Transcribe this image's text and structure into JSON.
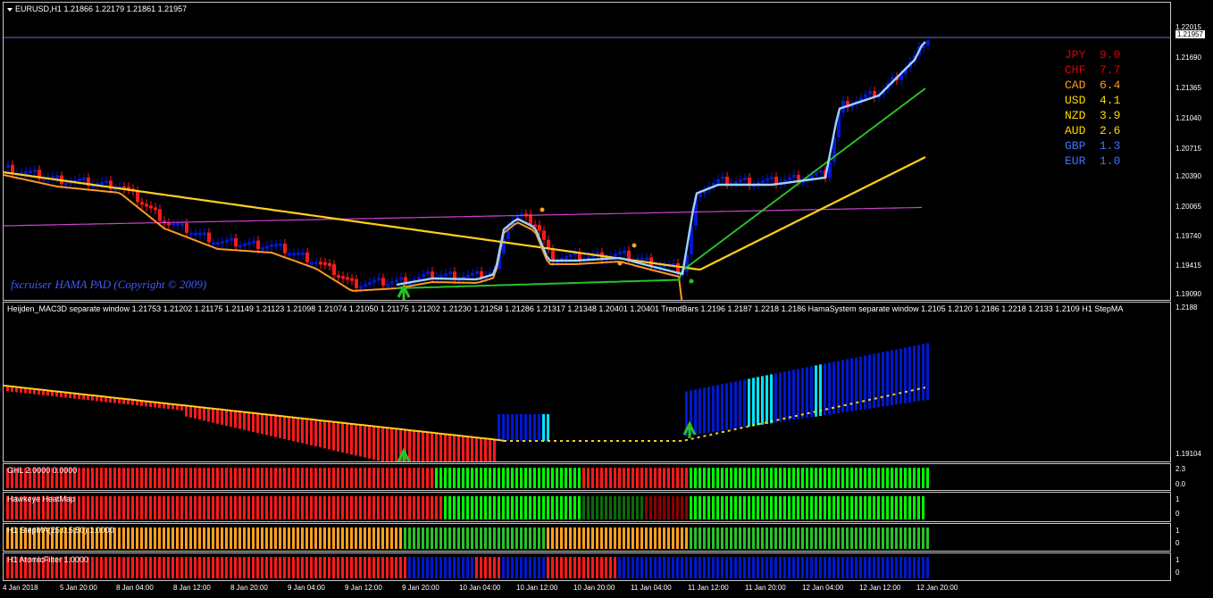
{
  "main_label": "EURUSD,H1  1.21866 1.22179 1.21861 1.21957",
  "copyright": "fxcruiser HAMA PAD (Copyright © 2009)",
  "price_axis": [
    "1.22015",
    "1.21957",
    "1.21690",
    "1.21365",
    "1.21040",
    "1.20715",
    "1.20390",
    "1.20065",
    "1.19740",
    "1.19415",
    "1.19090"
  ],
  "current_price": "1.21957",
  "strength": [
    {
      "cur": "JPY",
      "val": "9.0",
      "color": "#e00000"
    },
    {
      "cur": "CHF",
      "val": "7.7",
      "color": "#e00000"
    },
    {
      "cur": "CAD",
      "val": "6.4",
      "color": "#ff9a1e"
    },
    {
      "cur": "USD",
      "val": "4.1",
      "color": "#ffd700"
    },
    {
      "cur": "NZD",
      "val": "3.9",
      "color": "#ffd700"
    },
    {
      "cur": "AUD",
      "val": "2.6",
      "color": "#ffd700"
    },
    {
      "cur": "GBP",
      "val": "1.3",
      "color": "#4070ff"
    },
    {
      "cur": "EUR",
      "val": "1.0",
      "color": "#4070ff"
    }
  ],
  "sub1_label": "Heijden_MAC3D separate window 1.21753 1.21202 1.21175 1.21149 1.21123 1.21098 1.21074 1.21050 1.21175 1.21202 1.21230 1.21258 1.21286 1.21317 1.21348 1.20401 1.20401  TrendBars 1.2196 1.2187 1.2218 1.2186  HamaSystem separate window 1.2105 1.2120 1.2186 1.2218 1.2133 1.2109  H1 StepMA",
  "sub1_axis": [
    "1.2188",
    "1.19104"
  ],
  "ghl_label": "GHL 2.0000 0.0000",
  "ghl_axis": [
    "2.3",
    "0.0"
  ],
  "heatmap_label": "Hawkeye HeatMap",
  "heatmap_axis": [
    "1",
    "0"
  ],
  "stepma_label": "H1 StepMA(25,0.5,50) 1.0000",
  "stepma_axis": [
    "1",
    "0"
  ],
  "atomic_label": "H1 AtomicFilter 1.0000",
  "atomic_axis": [
    "1",
    "0"
  ],
  "time_axis": [
    "4 Jan 2018",
    "5 Jan 20:00",
    "8 Jan 04:00",
    "8 Jan 12:00",
    "8 Jan 20:00",
    "9 Jan 04:00",
    "9 Jan 12:00",
    "9 Jan 20:00",
    "10 Jan 04:00",
    "10 Jan 12:00",
    "10 Jan 20:00",
    "11 Jan 04:00",
    "11 Jan 12:00",
    "11 Jan 20:00",
    "12 Jan 04:00",
    "12 Jan 12:00",
    "12 Jan 20:00"
  ],
  "colors": {
    "bull": "#0018d0",
    "bear": "#ff1a1a",
    "light": "#00e5ff",
    "ma_fast": "#ff9a1e",
    "ma_slow": "#ffcf1f",
    "ma_green": "#28c228",
    "ma_blue": "#9fd0ff",
    "ma_magenta": "#d040d0",
    "green": "#00ff00",
    "orange": "#ffa020",
    "dgreen": "#0a6a0a"
  }
}
